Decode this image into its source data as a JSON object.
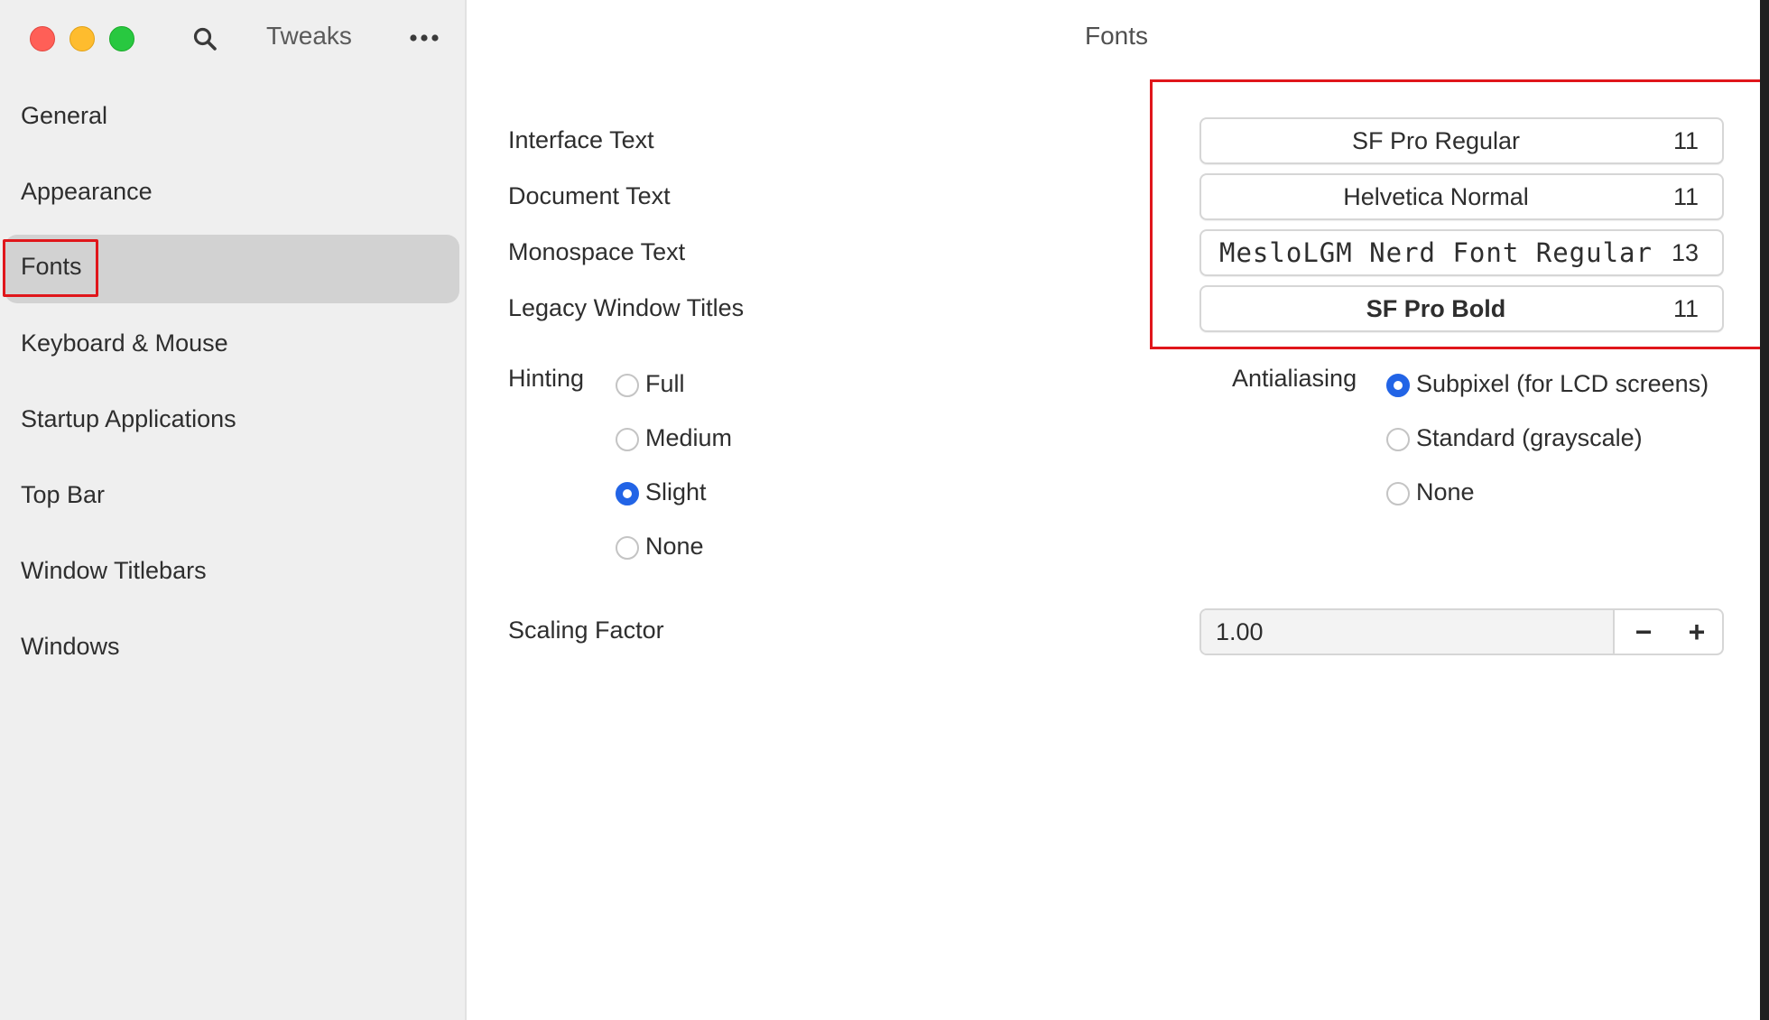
{
  "sidebar": {
    "title": "Tweaks",
    "icons": {
      "search": "search-icon",
      "more": "more-icon"
    },
    "items": [
      {
        "label": "General"
      },
      {
        "label": "Appearance"
      },
      {
        "label": "Fonts",
        "selected": true
      },
      {
        "label": "Keyboard & Mouse"
      },
      {
        "label": "Startup Applications"
      },
      {
        "label": "Top Bar"
      },
      {
        "label": "Window Titlebars"
      },
      {
        "label": "Windows"
      }
    ]
  },
  "main": {
    "title": "Fonts",
    "font_rows": [
      {
        "label": "Interface Text",
        "font": "SF Pro Regular",
        "size": "11"
      },
      {
        "label": "Document Text",
        "font": "Helvetica Normal",
        "size": "11"
      },
      {
        "label": "Monospace Text",
        "font": "MesloLGM Nerd Font Regular",
        "size": "13"
      },
      {
        "label": "Legacy Window Titles",
        "font": "SF Pro Bold",
        "size": "11"
      }
    ],
    "hinting": {
      "label": "Hinting",
      "options": [
        "Full",
        "Medium",
        "Slight",
        "None"
      ],
      "selected": "Slight"
    },
    "antialiasing": {
      "label": "Antialiasing",
      "options": [
        "Subpixel (for LCD screens)",
        "Standard (grayscale)",
        "None"
      ],
      "selected": "Subpixel (for LCD screens)"
    },
    "scaling": {
      "label": "Scaling Factor",
      "value": "1.00",
      "decrement": "−",
      "increment": "+"
    }
  },
  "colors": {
    "accent": "#2264e6",
    "highlight": "#e0161b",
    "close": "#ff5f57",
    "minimize": "#febc2e",
    "maximize": "#28c840"
  }
}
